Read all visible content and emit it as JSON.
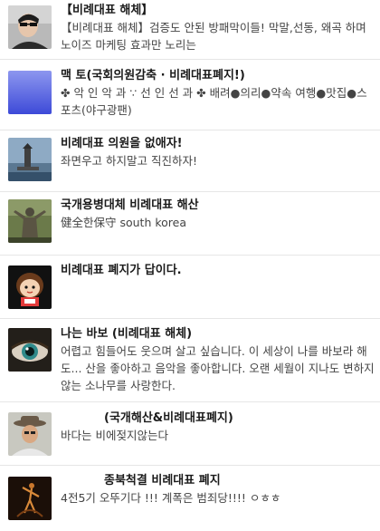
{
  "profiles": [
    {
      "name": "【비례대표 해체】",
      "bio": "【비례대표 해체】검증도 안된 방패막이들! 막말,선동, 왜곡 하며 노이즈 마케팅 효과만 노리는",
      "avatar_icon": "man-portrait-icon"
    },
    {
      "name": "맥 토(국회의원감축 · 비례대표폐지!)",
      "bio": "✤ 악 인 악 과 ∵ 선 인 선 과 ✤ 배려●의리●약속 여행●맛집●스포츠(야구광팬)",
      "avatar_icon": "blue-square-icon"
    },
    {
      "name": "비례대표 의원을 없애자!",
      "bio": "좌면우고 하지말고 직진하자!",
      "avatar_icon": "lighthouse-photo-icon"
    },
    {
      "name": "국개용병대체 비례대표 해산",
      "bio": "健全한保守 south korea",
      "avatar_icon": "statue-photo-icon"
    },
    {
      "name": "비례대표 폐지가 답이다.",
      "bio": "",
      "avatar_icon": "cartoon-character-icon"
    },
    {
      "name": "나는 바보 (비례대표 해체)",
      "bio": "어렵고 힘들어도 웃으며 살고 싶습니다. 이 세상이 나를 바보라 해도... 산을 좋아하고 음악을 좋아합니다. 오랜 세월이 지나도 변하지 않는 소나무를 사랑한다.",
      "avatar_icon": "eye-closeup-icon"
    },
    {
      "name": "(국개해산&비례대표폐지)",
      "bio": "바다는 비에젖지않는다",
      "avatar_icon": "man-with-hat-icon"
    },
    {
      "name": "종북척결 비례대표 폐지",
      "bio": "4전5기 오뚜기다 !!! 계폭은 범죄당!!!! ㅇㅎㅎ",
      "avatar_icon": "dancer-silhouette-icon"
    }
  ]
}
